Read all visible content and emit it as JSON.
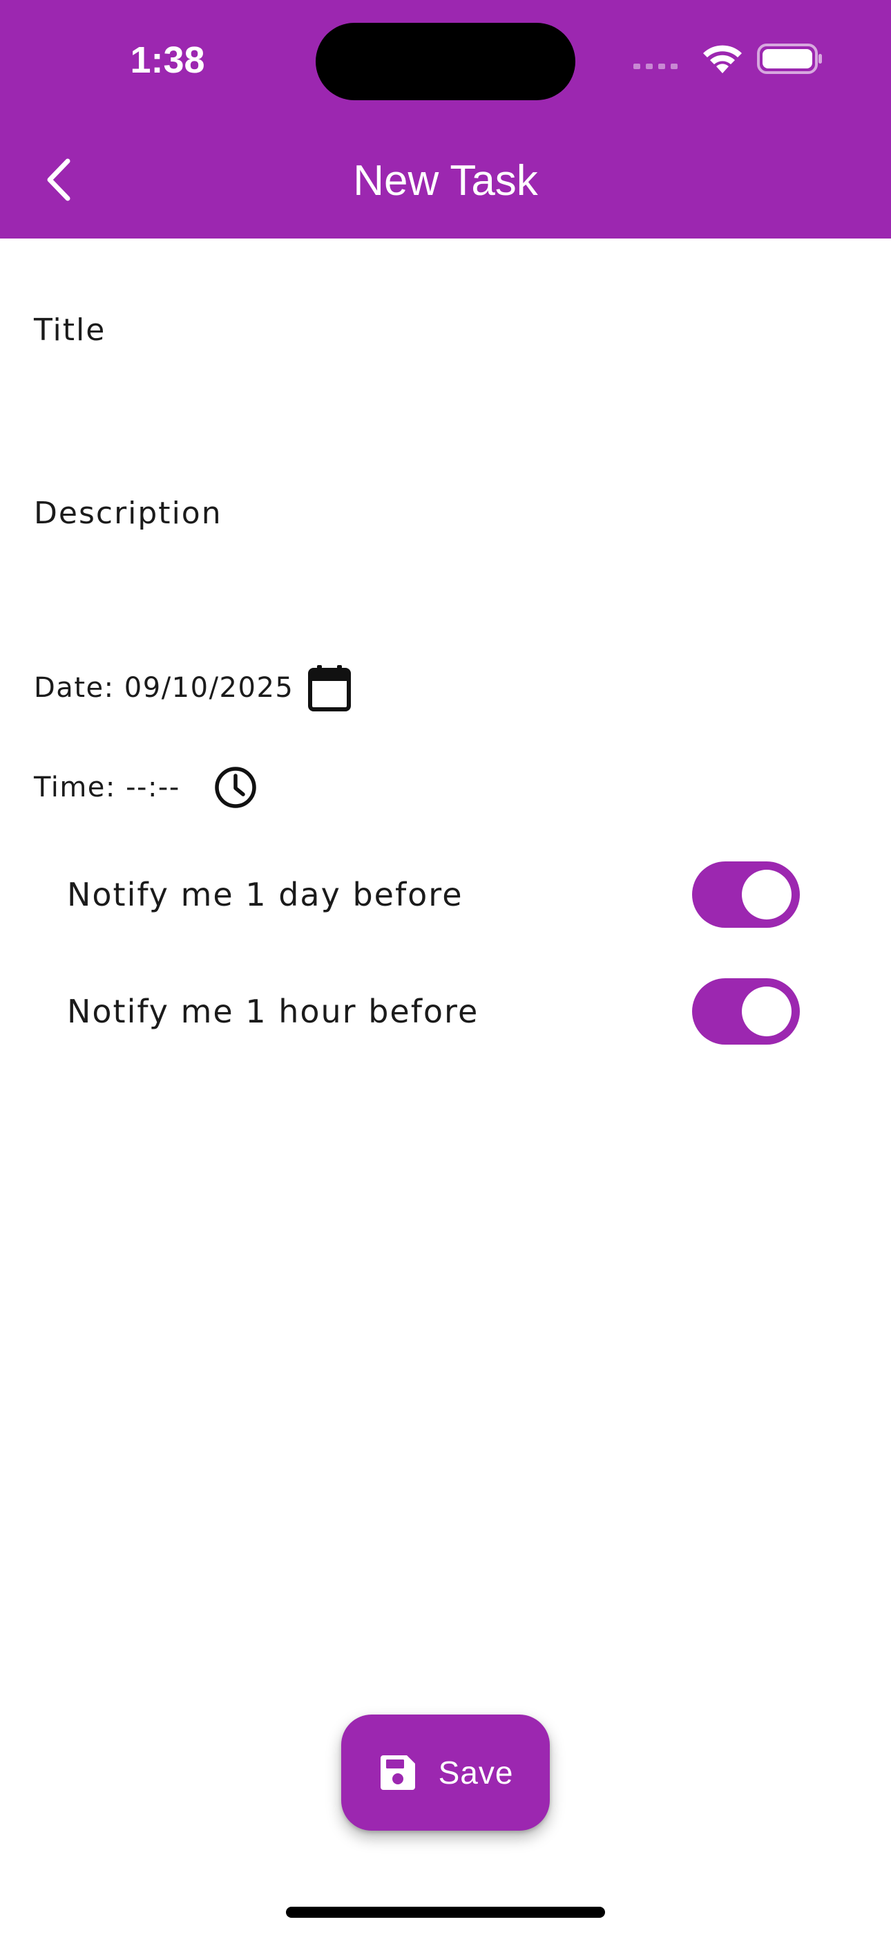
{
  "status_bar": {
    "time": "1:38"
  },
  "app_bar": {
    "title": "New Task",
    "background_color": "#9c27b0"
  },
  "form": {
    "title_label": "Title",
    "title_value": "",
    "description_label": "Description",
    "description_value": "",
    "date_text": "Date: 09/10/2025",
    "time_text": "Time: --:--"
  },
  "notifications": [
    {
      "label": "Notify me 1 day before",
      "enabled": true
    },
    {
      "label": "Notify me 1 hour before",
      "enabled": true
    }
  ],
  "actions": {
    "save_label": "Save"
  },
  "icons": {
    "back": "chevron-left-icon",
    "calendar": "calendar-icon",
    "clock": "clock-icon",
    "save": "floppy-disk-icon",
    "wifi": "wifi-icon",
    "battery": "battery-icon",
    "signal": "cellular-signal-icon"
  },
  "colors": {
    "accent": "#9c27b0",
    "on_accent": "#ffffff",
    "text": "#1b1b1b"
  }
}
